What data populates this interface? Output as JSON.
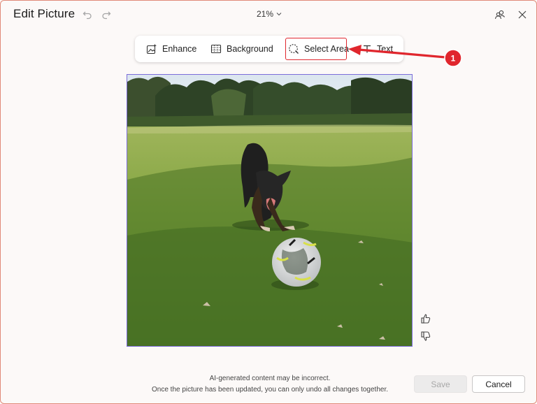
{
  "dialog": {
    "title": "Edit Picture",
    "zoom": "21%"
  },
  "toolbar": {
    "enhance_label": "Enhance",
    "background_label": "Background",
    "select_area_label": "Select Area",
    "text_label": "Text"
  },
  "annotation": {
    "number": "1",
    "color": "#e0262d"
  },
  "footer": {
    "disclaimer": "AI-generated content may be incorrect.",
    "note": "Once the picture has been updated, you can only undo all changes together."
  },
  "actions": {
    "save_label": "Save",
    "cancel_label": "Cancel"
  },
  "colors": {
    "selection_border": "#7b6cd9",
    "dialog_border": "#e08a78"
  }
}
